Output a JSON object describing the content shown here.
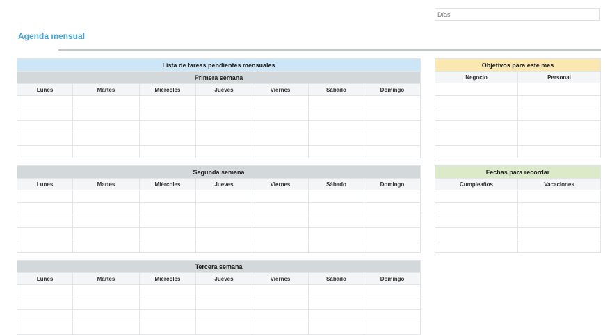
{
  "header": {
    "days_label": "Días",
    "title": "Agenda mensual"
  },
  "week1": {
    "list_title": "Lista de tareas pendientes mensuales",
    "title": "Primera semana",
    "days": [
      "Lunes",
      "Martes",
      "Miércoles",
      "Jueves",
      "Viernes",
      "Sábado",
      "Domingo"
    ]
  },
  "week2": {
    "title": "Segunda semana",
    "days": [
      "Lunes",
      "Martes",
      "Miércoles",
      "Jueves",
      "Viernes",
      "Sábado",
      "Domingo"
    ]
  },
  "week3": {
    "title": "Tercera semana",
    "days": [
      "Lunes",
      "Martes",
      "Miércoles",
      "Jueves",
      "Viernes",
      "Sábado",
      "Domingo"
    ]
  },
  "goals": {
    "title": "Objetivos para este mes",
    "columns": [
      "Negocio",
      "Personal"
    ]
  },
  "dates": {
    "title": "Fechas para recordar",
    "columns": [
      "Cumpleaños",
      "Vacaciones"
    ]
  },
  "colors": {
    "title_blue": "#4aa3e0",
    "header_blue": "#cde6f7",
    "header_gray": "#d3d8da",
    "header_yellow": "#fbe8b0",
    "header_green": "#dceac9"
  }
}
